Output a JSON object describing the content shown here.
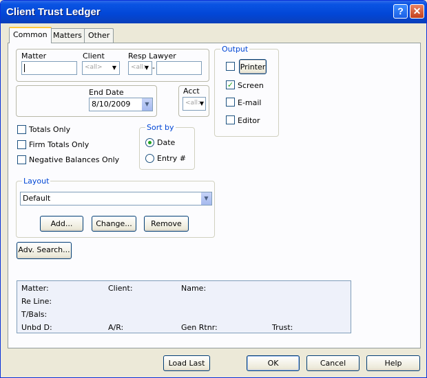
{
  "window": {
    "title": "Client Trust Ledger",
    "help_glyph": "?",
    "close_glyph": "✕"
  },
  "tabs": [
    "Common",
    "Matters",
    "Other"
  ],
  "matter_group": {
    "matter_label": "Matter",
    "matter_value": "",
    "client_label": "Client",
    "client_value": "<all>",
    "resp_lawyer_label": "Resp Lawyer",
    "resp_lawyer_value": "<all>",
    "resp_lawyer_sep": "-"
  },
  "end_date": {
    "label": "End Date",
    "value": "8/10/2009"
  },
  "acct": {
    "label": "Acct",
    "value": "<all>"
  },
  "output": {
    "title": "Output",
    "options": [
      {
        "label": "Printer",
        "checked": false
      },
      {
        "label": "Screen",
        "checked": true
      },
      {
        "label": "E-mail",
        "checked": false
      },
      {
        "label": "Editor",
        "checked": false
      }
    ]
  },
  "options": {
    "totals_only": "Totals Only",
    "firm_totals_only": "Firm Totals Only",
    "negative_balances_only": "Negative Balances Only"
  },
  "sort_by": {
    "title": "Sort by",
    "options": [
      "Date",
      "Entry #"
    ],
    "selected": "Date"
  },
  "layout": {
    "title": "Layout",
    "value": "Default",
    "add_label": "Add...",
    "change_label": "Change...",
    "remove_label": "Remove"
  },
  "adv_search_label": "Adv. Search...",
  "info": {
    "matter": "Matter:",
    "client": "Client:",
    "name": "Name:",
    "re_line": "Re Line:",
    "tbals": "T/Bals:",
    "unbd": "Unbd D:",
    "ar": "A/R:",
    "gen_rtnr": "Gen Rtnr:",
    "trust": "Trust:"
  },
  "footer": {
    "load_last": "Load Last",
    "ok": "OK",
    "cancel": "Cancel",
    "help": "Help"
  },
  "colors": {
    "titlebar": "#0a54e3",
    "group_label": "#0046d5",
    "check": "#21a121"
  }
}
